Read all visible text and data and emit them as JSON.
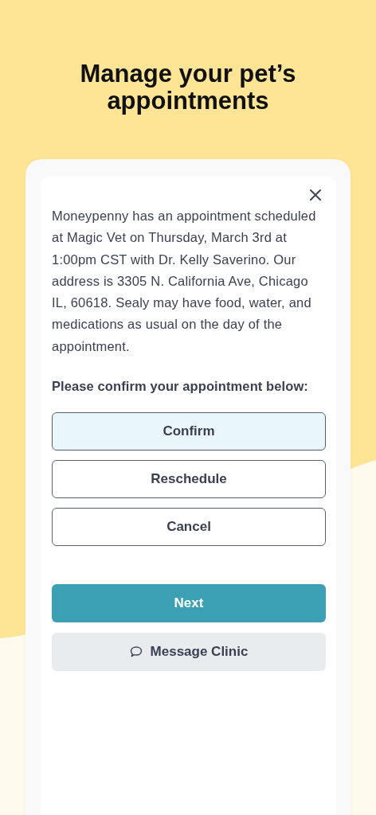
{
  "title": "Manage your pet’s appointments",
  "message": "Moneypenny has an appointment scheduled at Magic Vet on Thursday, March 3rd at 1:00pm CST with Dr. Kelly Saverino. Our address is 3305 N. California Ave, Chicago IL, 60618. Sealy may have food, water, and medications as usual on the day of the appointment.",
  "prompt": "Please confirm your appointment below:",
  "options": [
    {
      "label": "Confirm",
      "selected": true
    },
    {
      "label": "Reschedule",
      "selected": false
    },
    {
      "label": "Cancel",
      "selected": false
    }
  ],
  "next_button": "Next",
  "message_button": "Message Clinic"
}
